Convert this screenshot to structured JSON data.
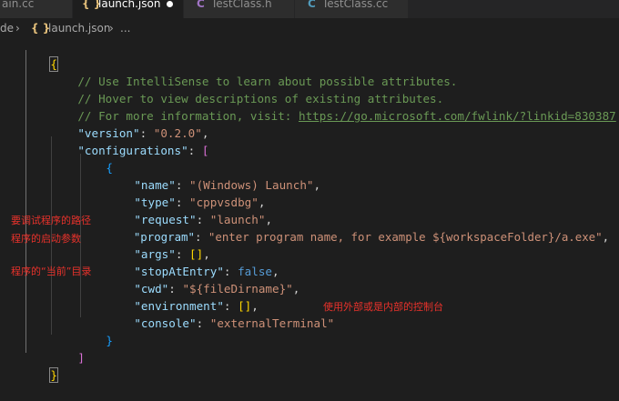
{
  "tabs": [
    {
      "icon": "",
      "label": "ain.cc",
      "active": false
    },
    {
      "icon": "{ }",
      "label": "launch.json",
      "active": true,
      "modified": true
    },
    {
      "icon": "C",
      "label": "TestClass.h",
      "active": false
    },
    {
      "icon": "C",
      "label": "TestClass.cc",
      "active": false
    }
  ],
  "breadcrumb": {
    "folder": "de",
    "file_icon": "{ }",
    "file": "launch.json",
    "more": "..."
  },
  "code": {
    "l1": "{",
    "comment1": "// Use IntelliSense to learn about possible attributes.",
    "comment2": "// Hover to view descriptions of existing attributes.",
    "comment3_prefix": "// For more information, visit: ",
    "comment3_link": "https://go.microsoft.com/fwlink/?linkid=830387",
    "version_key": "\"version\"",
    "version_val": "\"0.2.0\"",
    "configs_key": "\"configurations\"",
    "open_bracket": "[",
    "open_brace": "{",
    "name_key": "\"name\"",
    "name_val": "\"(Windows) Launch\"",
    "type_key": "\"type\"",
    "type_val": "\"cppvsdbg\"",
    "request_key": "\"request\"",
    "request_val": "\"launch\"",
    "program_key": "\"program\"",
    "program_val": "\"enter program name, for example ${workspaceFolder}/a.exe\"",
    "args_key": "\"args\"",
    "args_val": "[]",
    "stop_key": "\"stopAtEntry\"",
    "stop_val": "false",
    "cwd_key": "\"cwd\"",
    "cwd_val": "\"${fileDirname}\"",
    "env_key": "\"environment\"",
    "env_val": "[]",
    "console_key": "\"console\"",
    "console_val": "\"externalTerminal\"",
    "close_brace": "}",
    "close_bracket": "]",
    "close_root": "}"
  },
  "annotations": {
    "program": "要调试程序的路径",
    "args": "程序的启动参数",
    "cwd": "程序的“当前”目录",
    "console": "使用外部或是内部的控制台"
  },
  "colors": {
    "annotation": "#e8322b",
    "comment": "#6a9955",
    "key": "#9cdcfe",
    "string": "#ce9178",
    "keyword": "#569cd6"
  }
}
